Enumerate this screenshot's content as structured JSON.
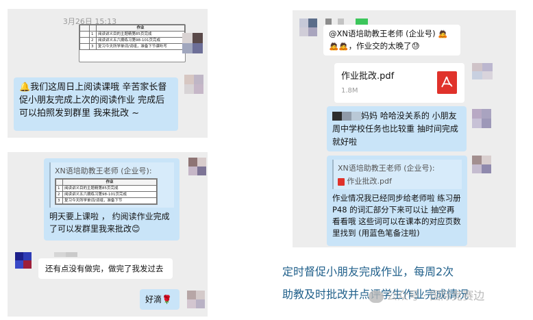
{
  "panel1": {
    "timestamp": "3月26日 15:13",
    "table": {
      "header": [
        "",
        "",
        "作业"
      ],
      "rows": [
        [
          "",
          "1",
          "阅读讲义目的主题精第85页完成"
        ],
        [
          "",
          "2",
          "阅读讲义五六摘练习第98-101页完成"
        ],
        [
          "",
          "3",
          "复习今天所学单词/词组，准备下节课听写"
        ]
      ]
    },
    "message": "🔔我们这周日上阅读课哦 辛苦家长督促小朋友完成上次的阅读作业 完成后可以拍照发到群里 我来批改 ~"
  },
  "panel2": {
    "quote_title": "XN语培助教王老师 (企业号):",
    "table": {
      "header": [
        "",
        "作业"
      ],
      "rows": [
        [
          "1",
          "阅读讲义目的主题精第85页完成"
        ],
        [
          "2",
          "阅读讲义五六摘练习第98-101页完成"
        ],
        [
          "3",
          "复习今天所学单词/词组，准备下节"
        ]
      ]
    },
    "reply_text": "明天要上课啦 ，  约阅读作业完成了可以发群里我来批改😊",
    "parent_reply": "还有点没有做完，做完了我发过去",
    "teacher_ok": "好滴🌹"
  },
  "panel3": {
    "mention": "@XN语培助教王老师 (企业号) 🙇 🙇🙇，作业交的太晚了😓",
    "file_name": "作业批改.pdf",
    "file_size": "1.8M",
    "parent_msg": "妈妈 哈哈没关系的 小朋友周中学校任务也比较重 抽时间完成就好啦",
    "quote_title": "XN语培助教王老师 (企业号):",
    "quote_file": "作业批改.pdf",
    "feedback": "作业情况我已经同步给老师啦 练习册 P48 的词汇部分下来可以让 抽空再看看哦 这些词可以在课本的对应页数里找到 (用蓝色笔备注啦)"
  },
  "caption": {
    "line1": "定时督促小朋友完成作业，每周2次",
    "line2": "助教及时批改并点评学生作业完成情况"
  },
  "watermark": "公众号 · 国际竞赛边",
  "colors": {
    "chat_bg": "#ededed",
    "bubble_blue": "#c9e4f8",
    "pdf_red": "#e0322b",
    "caption_blue": "#1f5f8a"
  }
}
